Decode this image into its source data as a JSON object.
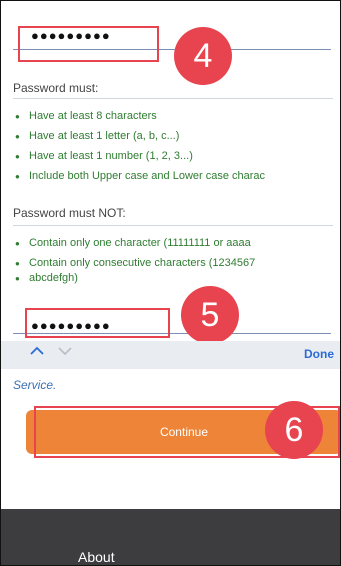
{
  "password_field": {
    "masked_value": "●●●●●●●●●"
  },
  "confirm_field": {
    "masked_value": "●●●●●●●●●"
  },
  "rules": {
    "must_title": "Password must:",
    "must": [
      "Have at least 8 characters",
      "Have at least 1 letter (a, b, c...)",
      "Have at least 1 number (1, 2, 3...)",
      "Include both Upper case and Lower case charac"
    ],
    "must_not_title": "Password must NOT:",
    "must_not": [
      "Contain only one character (11111111 or aaaa",
      "Contain only consecutive characters (1234567",
      "abcdefgh)"
    ]
  },
  "badges": {
    "step4": "4",
    "step5": "5",
    "step6": "6"
  },
  "keyboard_bar": {
    "prev_icon": "chevron-up-icon",
    "next_icon": "chevron-down-icon",
    "done_label": "Done"
  },
  "terms": {
    "service_text": "Service."
  },
  "continue_button": {
    "label": "Continue",
    "color": "#ee8437"
  },
  "footer": {
    "about_label": "About"
  },
  "colors": {
    "highlight": "#e8444f",
    "rule_text": "#2f7d32",
    "link": "#3d6fb5",
    "footer_bg": "#3d3d40"
  }
}
